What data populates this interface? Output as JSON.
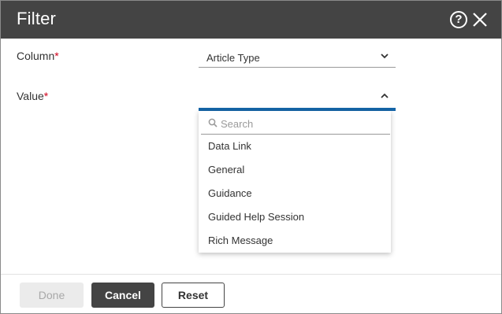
{
  "dialog": {
    "title": "Filter",
    "help_icon": "question-circle-icon",
    "close_icon": "close-icon"
  },
  "fields": {
    "column": {
      "label": "Column",
      "required_marker": "*",
      "selected": "Article Type"
    },
    "value": {
      "label": "Value",
      "required_marker": "*",
      "selected": ""
    }
  },
  "dropdown": {
    "search_placeholder": "Search",
    "options": [
      "Data Link",
      "General",
      "Guidance",
      "Guided Help Session",
      "Rich Message"
    ]
  },
  "footer": {
    "done_label": "Done",
    "cancel_label": "Cancel",
    "reset_label": "Reset"
  },
  "colors": {
    "header_bg": "#444444",
    "required": "#d0021b",
    "focus_accent": "#1565a8"
  }
}
